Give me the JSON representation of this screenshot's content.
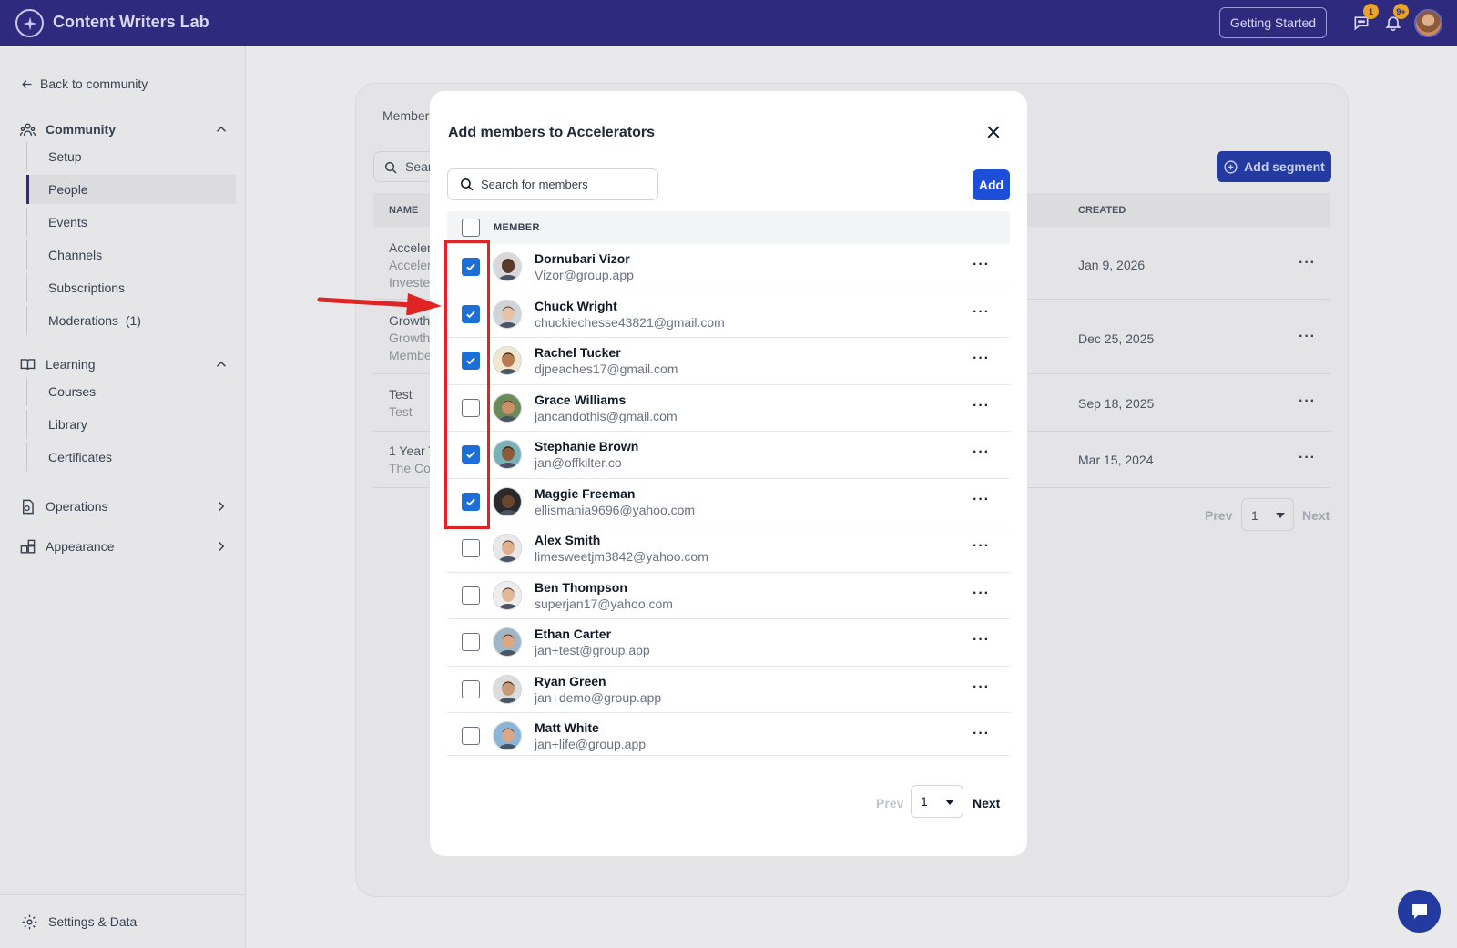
{
  "app": {
    "title": "Content Writers Lab",
    "getting_started": "Getting Started",
    "chat_badge": "1",
    "notif_badge": "9+"
  },
  "sidebar": {
    "back": "Back to community",
    "community": {
      "label": "Community",
      "items": [
        "Setup",
        "People",
        "Events",
        "Channels",
        "Subscriptions",
        "Moderations  (1)"
      ],
      "active": "People"
    },
    "learning": {
      "label": "Learning",
      "items": [
        "Courses",
        "Library",
        "Certificates"
      ]
    },
    "operations": "Operations",
    "appearance": "Appearance",
    "settings": "Settings & Data"
  },
  "background": {
    "tab": "Member",
    "search_placeholder": "Sear",
    "add_segment": "Add segment",
    "columns": {
      "name": "NAME",
      "created": "CREATED"
    },
    "rows": [
      {
        "l1": "Acceler",
        "l2": "Acceler",
        "l3": "Investe",
        "created": "Jan 9, 2026"
      },
      {
        "l1": "Growth",
        "l2": "Growth",
        "l3": "Membe",
        "created": "Dec 25, 2025"
      },
      {
        "l1": "Test",
        "l2": "Test",
        "l3": "",
        "created": "Sep 18, 2025"
      },
      {
        "l1": "1 Year T",
        "l2": "The Co",
        "l3": "",
        "created": "Mar 15, 2024"
      }
    ],
    "pagination": {
      "prev": "Prev",
      "page": "1",
      "next": "Next"
    }
  },
  "modal": {
    "title": "Add members to Accelerators",
    "search_placeholder": "Search for members",
    "add_label": "Add",
    "column_member": "MEMBER",
    "members": [
      {
        "name": "Dornubari Vizor",
        "email": "Vizor@group.app",
        "checked": true,
        "skin": "#5a3a28",
        "hair": "#1a1a1a",
        "bg": "#d8d8d8"
      },
      {
        "name": "Chuck Wright",
        "email": "chuckiechesse43821@gmail.com",
        "checked": true,
        "skin": "#e6c2a6",
        "hair": "#3a3a3a",
        "bg": "#cfd4d8"
      },
      {
        "name": "Rachel Tucker",
        "email": "djpeaches17@gmail.com",
        "checked": true,
        "skin": "#b87a52",
        "hair": "#2a1a12",
        "bg": "#f2e6cc"
      },
      {
        "name": "Grace Williams",
        "email": "jancandothis@gmail.com",
        "checked": false,
        "skin": "#c9926a",
        "hair": "#3d2a1a",
        "bg": "#6a8a5a"
      },
      {
        "name": "Stephanie Brown",
        "email": "jan@offkilter.co",
        "checked": true,
        "skin": "#8a5a3a",
        "hair": "#1c1410",
        "bg": "#7ab0b8"
      },
      {
        "name": "Maggie Freeman",
        "email": "ellismania9696@yahoo.com",
        "checked": true,
        "skin": "#6a4530",
        "hair": "#101010",
        "bg": "#2a2a2a"
      },
      {
        "name": "Alex Smith",
        "email": "limesweetjm3842@yahoo.com",
        "checked": false,
        "skin": "#e0b090",
        "hair": "#5a3a22",
        "bg": "#e8e8e8"
      },
      {
        "name": "Ben Thompson",
        "email": "superjan17@yahoo.com",
        "checked": false,
        "skin": "#e2b89a",
        "hair": "#4a3020",
        "bg": "#ededed"
      },
      {
        "name": "Ethan Carter",
        "email": "jan+test@group.app",
        "checked": false,
        "skin": "#d8a888",
        "hair": "#2a2a2a",
        "bg": "#9fb6c8"
      },
      {
        "name": "Ryan Green",
        "email": "jan+demo@group.app",
        "checked": false,
        "skin": "#c89a78",
        "hair": "#1e1e1e",
        "bg": "#dcdcdc"
      },
      {
        "name": "Matt White",
        "email": "jan+life@group.app",
        "checked": false,
        "skin": "#d9a886",
        "hair": "#3a2a1e",
        "bg": "#8ab4d8"
      }
    ],
    "pagination": {
      "prev": "Prev",
      "page": "1",
      "next": "Next"
    }
  },
  "colors": {
    "topbar": "#2e2a7e",
    "primary": "#1d4ed8",
    "checkbox": "#1d6fd8",
    "annotation": "#e02424"
  }
}
